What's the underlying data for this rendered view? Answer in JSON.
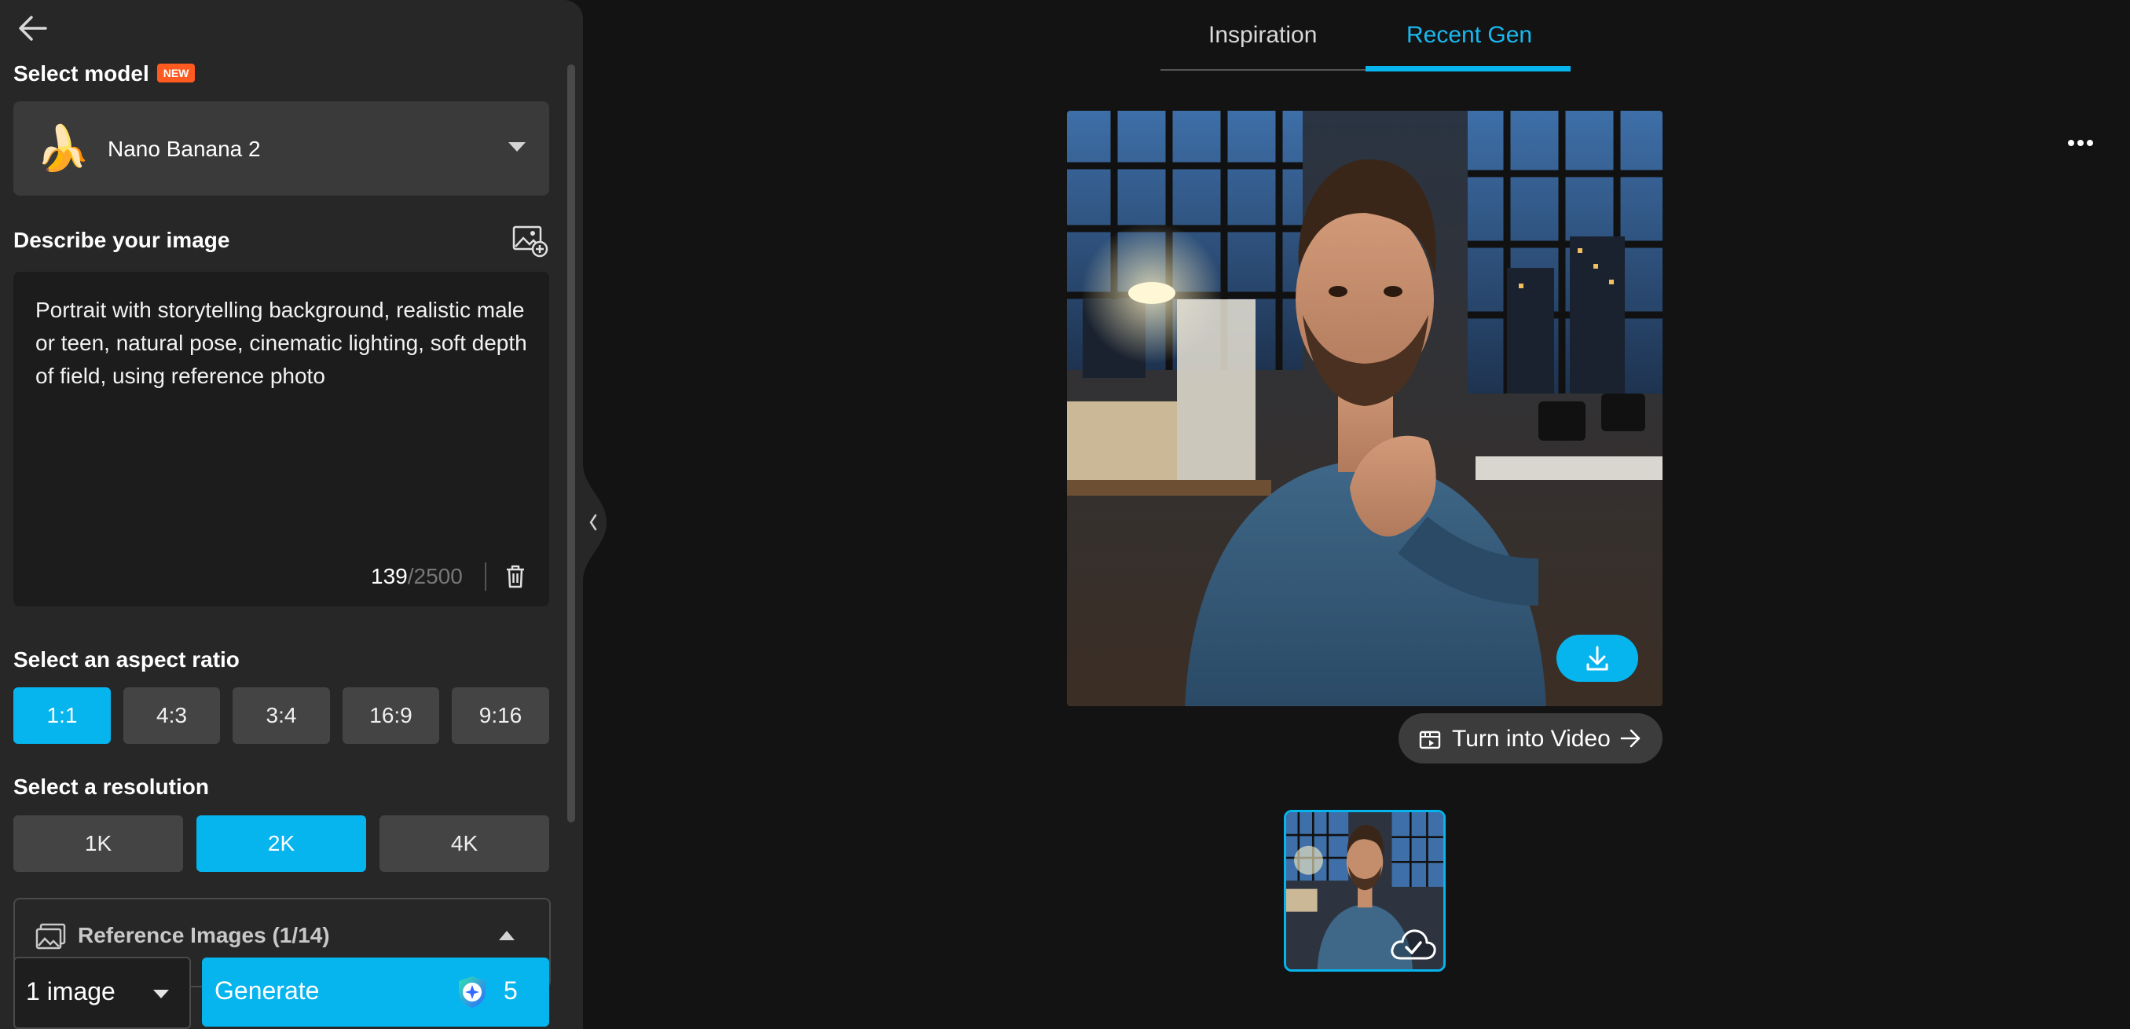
{
  "sidebar": {
    "select_model_label": "Select model",
    "new_badge": "NEW",
    "model": {
      "emoji": "🍌",
      "name": "Nano Banana 2"
    },
    "describe_label": "Describe your image",
    "prompt_text": "Portrait with storytelling background, realistic male or teen, natural pose, cinematic lighting, soft depth of field, using reference photo",
    "char_count": "139",
    "char_max": "/2500",
    "aspect_label": "Select an aspect ratio",
    "aspect_ratios": [
      "1:1",
      "4:3",
      "3:4",
      "16:9",
      "9:16"
    ],
    "aspect_selected": "1:1",
    "resolution_label": "Select a resolution",
    "resolutions": [
      "1K",
      "2K",
      "4K"
    ],
    "resolution_selected": "2K",
    "reference_label": "Reference Images (1/14)",
    "image_count": "1 image",
    "generate_label": "Generate",
    "credits": "5"
  },
  "main": {
    "tabs": [
      "Inspiration",
      "Recent Gen"
    ],
    "active_tab": "Recent Gen",
    "turn_into_video_label": "Turn into Video"
  },
  "colors": {
    "accent": "#06b4ee",
    "sidebar_bg": "#272727",
    "page_bg": "#131313",
    "badge": "#ff5a1f"
  }
}
